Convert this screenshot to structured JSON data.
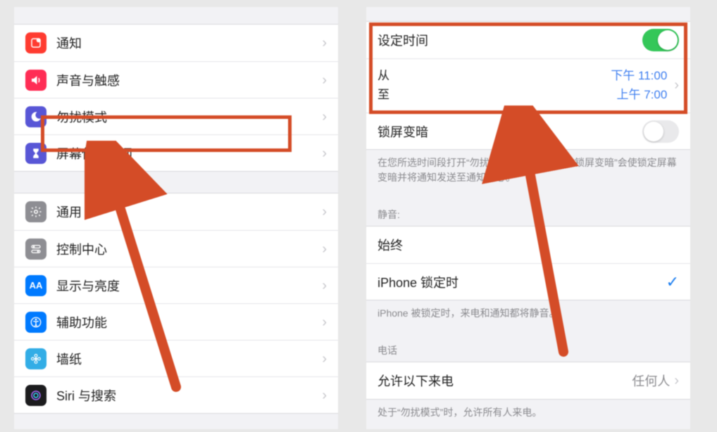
{
  "left": {
    "group1": [
      {
        "label": "通知",
        "icon": "notification-icon",
        "color": "bg-red"
      },
      {
        "label": "声音与触感",
        "icon": "sound-icon",
        "color": "bg-pink"
      },
      {
        "label": "勿扰模式",
        "icon": "moon-icon",
        "color": "bg-purple"
      },
      {
        "label": "屏幕使用时间",
        "icon": "hourglass-icon",
        "color": "bg-indigo"
      }
    ],
    "group2": [
      {
        "label": "通用",
        "icon": "gear-icon",
        "color": "bg-gray"
      },
      {
        "label": "控制中心",
        "icon": "switches-icon",
        "color": "bg-gray"
      },
      {
        "label": "显示与亮度",
        "icon": "aa-icon",
        "color": "bg-blue"
      },
      {
        "label": "辅助功能",
        "icon": "accessibility-icon",
        "color": "bg-blue"
      },
      {
        "label": "墙纸",
        "icon": "flower-icon",
        "color": "bg-teal"
      },
      {
        "label": "Siri 与搜索",
        "icon": "siri-icon",
        "color": "bg-black"
      }
    ]
  },
  "right": {
    "schedule_label": "设定时间",
    "schedule_on": true,
    "from_label": "从",
    "from_value": "下午 11:00",
    "to_label": "至",
    "to_value": "上午 7:00",
    "dim_label": "锁屏变暗",
    "dim_on": false,
    "dim_footer": "在您所选时间段打开“勿扰模式”。在此期间，“锁屏变暗”会使锁定屏幕变暗并将通知发送至通知中心。",
    "silence_header": "静音:",
    "always_label": "始终",
    "locked_label": "iPhone 锁定时",
    "locked_checked": true,
    "silence_footer": "iPhone 被锁定时，来电和通知都将静音。",
    "phone_header": "电话",
    "allow_calls_label": "允许以下来电",
    "allow_calls_value": "任何人",
    "allow_calls_footer": "处于“勿扰模式”时，允许所有人来电。"
  }
}
